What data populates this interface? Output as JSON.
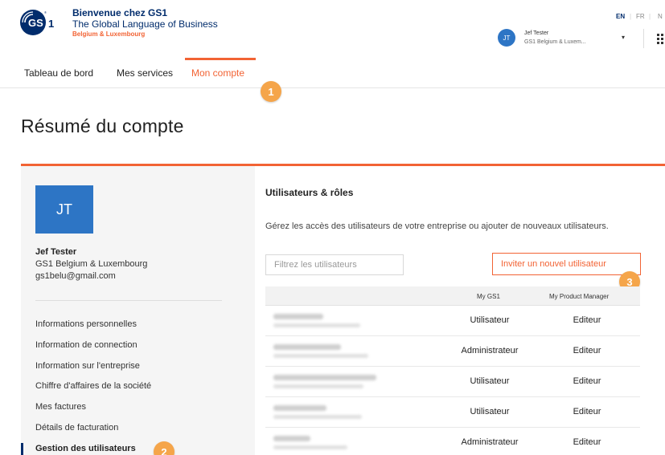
{
  "brand": {
    "title": "Bienvenue chez GS1",
    "tagline": "The Global Language of Business",
    "region": "Belgium & Luxembourg",
    "logo_text": "GS1",
    "primary_color": "#002c6c",
    "accent_color": "#f26334"
  },
  "languages": [
    "EN",
    "FR",
    "N"
  ],
  "user_menu": {
    "initials": "JT",
    "name": "Jef Tester",
    "org": "GS1 Belgium & Luxem...",
    "caret_icon": "caret-down-icon",
    "apps_icon": "grid-apps-icon"
  },
  "nav": {
    "tabs": [
      {
        "label": "Tableau de bord"
      },
      {
        "label": "Mes services"
      },
      {
        "label": "Mon compte"
      }
    ],
    "active_tab": "Mon compte"
  },
  "badges": [
    "1",
    "2",
    "3"
  ],
  "page_title": "Résumé du compte",
  "sidebar": {
    "initials": "JT",
    "name": "Jef Tester",
    "org": "GS1 Belgium & Luxembourg",
    "email": "gs1belu@gmail.com",
    "items": [
      {
        "label": "Informations personnelles"
      },
      {
        "label": "Information de connection"
      },
      {
        "label": "Information sur l'entreprise"
      },
      {
        "label": "Chiffre d'affaires de la société"
      },
      {
        "label": "Mes factures"
      },
      {
        "label": "Détails de facturation"
      },
      {
        "label": "Gestion des utilisateurs"
      }
    ],
    "active_item": "Gestion des utilisateurs"
  },
  "users_section": {
    "title": "Utilisateurs & rôles",
    "description": "Gérez les accès des utilisateurs de votre entreprise ou ajouter de nouveaux utilisateurs.",
    "filter_placeholder": "Filtrez les utilisateurs",
    "invite_label": "Inviter un nouvel utilisateur",
    "columns": [
      "My GS1",
      "My Product Manager"
    ],
    "rows": [
      {
        "my_gs1": "Utilisateur",
        "product_manager": "Editeur"
      },
      {
        "my_gs1": "Administrateur",
        "product_manager": "Editeur"
      },
      {
        "my_gs1": "Utilisateur",
        "product_manager": "Editeur"
      },
      {
        "my_gs1": "Utilisateur",
        "product_manager": "Editeur"
      },
      {
        "my_gs1": "Administrateur",
        "product_manager": "Editeur"
      }
    ]
  }
}
